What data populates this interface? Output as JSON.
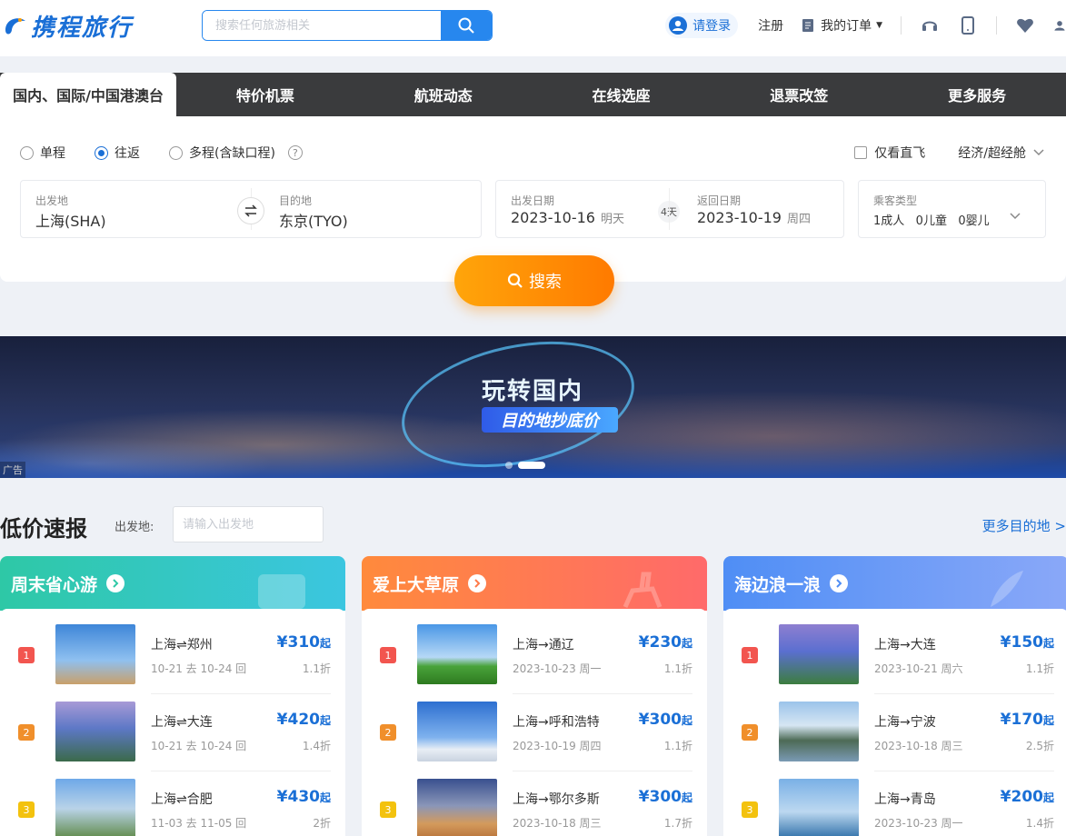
{
  "header": {
    "logo_text": "携程旅行",
    "search_placeholder": "搜索任何旅游相关",
    "login": "请登录",
    "register": "注册",
    "orders": "我的订单"
  },
  "tabs": [
    "国内、国际/中国港澳台",
    "特价机票",
    "航班动态",
    "在线选座",
    "退票改签",
    "更多服务"
  ],
  "trip": {
    "radios": [
      "单程",
      "往返",
      "多程(含缺口程)"
    ],
    "selected": "往返",
    "direct_only": "仅看直飞",
    "cabin": "经济/超经舱",
    "from_label": "出发地",
    "from": "上海(SHA)",
    "to_label": "目的地",
    "to": "东京(TYO)",
    "depart_label": "出发日期",
    "depart": "2023-10-16",
    "depart_day": "明天",
    "nights": "4天",
    "return_label": "返回日期",
    "return": "2023-10-19",
    "return_day": "周四",
    "pax_label": "乘客类型",
    "pax": "1成人   0儿童   0婴儿",
    "search": "搜索"
  },
  "banner": {
    "title": "玩转国内",
    "subtitle": "目的地抄底价",
    "ad": "广告"
  },
  "lowprice": {
    "title": "低价速报",
    "from_label": "出发地:",
    "from_placeholder": "请输入出发地",
    "more": "更多目的地 >"
  },
  "cards": [
    {
      "title": "周末省心游",
      "color_from": "#2ec8a6",
      "color_to": "#3bc6e0",
      "items": [
        {
          "rank": "1",
          "route": "上海⇌郑州",
          "date": "10-21 去 10-24 回",
          "price": "¥310",
          "unit": "起",
          "disc": "1.1折"
        },
        {
          "rank": "2",
          "route": "上海⇌大连",
          "date": "10-21 去 10-24 回",
          "price": "¥420",
          "unit": "起",
          "disc": "1.4折"
        },
        {
          "rank": "3",
          "route": "上海⇌合肥",
          "date": "11-03 去 11-05 回",
          "price": "¥430",
          "unit": "起",
          "disc": "2折"
        }
      ]
    },
    {
      "title": "爱上大草原",
      "color_from": "#ff8a3c",
      "color_to": "#ff6a6a",
      "items": [
        {
          "rank": "1",
          "route": "上海→通辽",
          "date": "2023-10-23 周一",
          "price": "¥230",
          "unit": "起",
          "disc": "1.1折"
        },
        {
          "rank": "2",
          "route": "上海→呼和浩特",
          "date": "2023-10-19 周四",
          "price": "¥300",
          "unit": "起",
          "disc": "1.1折"
        },
        {
          "rank": "3",
          "route": "上海→鄂尔多斯",
          "date": "2023-10-18 周三",
          "price": "¥300",
          "unit": "起",
          "disc": "1.7折"
        }
      ]
    },
    {
      "title": "海边浪一浪",
      "color_from": "#4f8ef5",
      "color_to": "#8aa8f8",
      "items": [
        {
          "rank": "1",
          "route": "上海→大连",
          "date": "2023-10-21 周六",
          "price": "¥150",
          "unit": "起",
          "disc": "1.1折"
        },
        {
          "rank": "2",
          "route": "上海→宁波",
          "date": "2023-10-18 周三",
          "price": "¥170",
          "unit": "起",
          "disc": "2.5折"
        },
        {
          "rank": "3",
          "route": "上海→青岛",
          "date": "2023-10-23 周一",
          "price": "¥200",
          "unit": "起",
          "disc": "1.4折"
        }
      ]
    }
  ]
}
